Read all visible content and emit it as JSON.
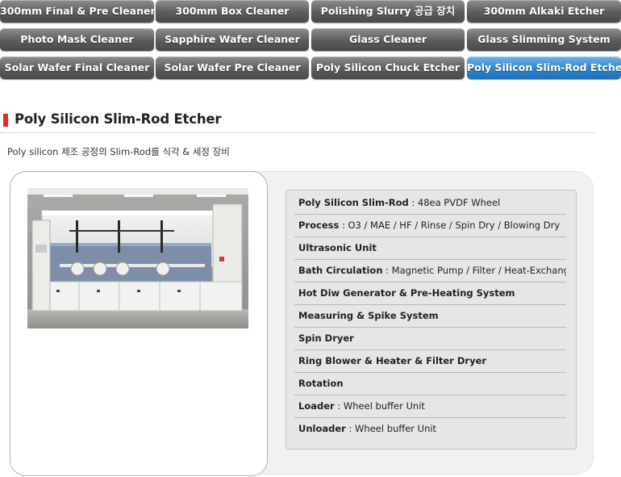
{
  "tabs": [
    {
      "label": "300mm Final & Pre Cleaner",
      "active": false
    },
    {
      "label": "300mm Box Cleaner",
      "active": false
    },
    {
      "label": "Polishing Slurry 공급 장치",
      "active": false
    },
    {
      "label": "300mm Alkaki Etcher",
      "active": false
    },
    {
      "label": "Photo Mask Cleaner",
      "active": false
    },
    {
      "label": "Sapphire Wafer Cleaner",
      "active": false
    },
    {
      "label": "Glass Cleaner",
      "active": false
    },
    {
      "label": "Glass Slimming System",
      "active": false
    },
    {
      "label": "Solar Wafer Final Cleaner",
      "active": false
    },
    {
      "label": "Solar Wafer Pre Cleaner",
      "active": false
    },
    {
      "label": "Poly Silicon Chuck Etcher",
      "active": false
    },
    {
      "label": "Poly Silicon Slim-Rod Etcher",
      "active": true
    }
  ],
  "page": {
    "title": "Poly Silicon Slim-Rod Etcher",
    "subtitle": "Poly silicon 제조 공정의 Slim-Rod를 식각 & 세정 장비"
  },
  "specs": [
    {
      "label": "Poly Silicon Slim-Rod",
      "value": " : 48ea PVDF Wheel"
    },
    {
      "label": "Process",
      "value": " : O3 / MAE / HF / Rinse / Spin Dry / Blowing Dry"
    },
    {
      "label": "Ultrasonic Unit",
      "value": ""
    },
    {
      "label": "Bath Circulation",
      "value": " : Magnetic Pump / Filter / Heat-Exchanger"
    },
    {
      "label": "Hot Diw Generator & Pre-Heating System",
      "value": ""
    },
    {
      "label": "Measuring & Spike System",
      "value": ""
    },
    {
      "label": "Spin Dryer",
      "value": ""
    },
    {
      "label": "Ring Blower & Heater & Filter Dryer",
      "value": ""
    },
    {
      "label": "Rotation",
      "value": ""
    },
    {
      "label": "Loader",
      "value": " : Wheel buffer Unit"
    },
    {
      "label": "Unloader",
      "value": " : Wheel buffer Unit"
    }
  ],
  "colors": {
    "tab_inactive": "#5c5c5c",
    "tab_active": "#2f85cc",
    "title_accent": "#d9302c"
  }
}
